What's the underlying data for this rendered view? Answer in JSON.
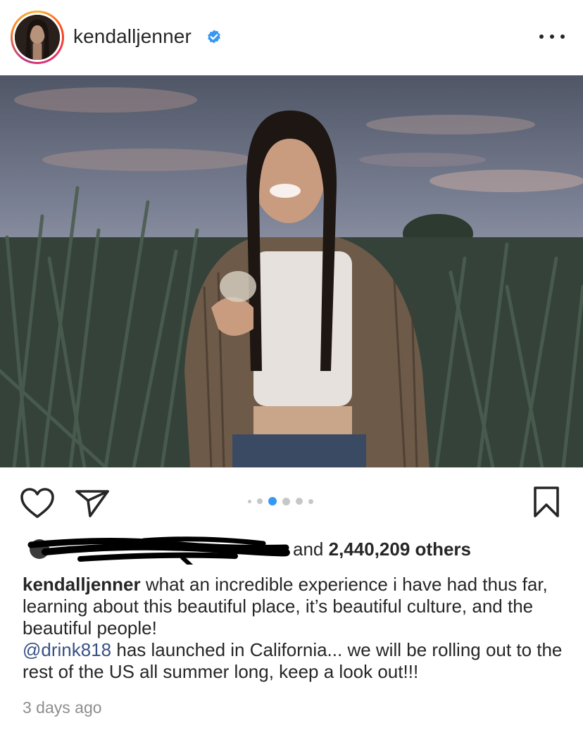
{
  "header": {
    "username": "kendalljenner",
    "verified_color": "#3897f0",
    "avatar_icon": "profile-photo",
    "more_icon": "more-horizontal-icon"
  },
  "post": {
    "image_alt": "Photo of a woman smiling holding a glass in an agave field at dusk",
    "carousel": {
      "count": 6,
      "active_index": 2
    }
  },
  "actions": {
    "like_icon": "heart-icon",
    "share_icon": "paper-plane-icon",
    "save_icon": "bookmark-icon"
  },
  "likes": {
    "prefix": "and",
    "count": "2,440,209",
    "suffix": "others"
  },
  "caption": {
    "username": "kendalljenner",
    "line1": " what an incredible experience i have had thus far, learning about this beautiful place, it’s beautiful culture, and the beautiful people!",
    "mention": "@drink818",
    "line2": " has launched in California... we will be rolling out to the rest of the US all summer long, keep a look out!!!"
  },
  "timestamp": "3 days ago",
  "colors": {
    "text": "#262626",
    "muted": "#8e8e8e",
    "link": "#385185",
    "accent": "#3897f0"
  }
}
